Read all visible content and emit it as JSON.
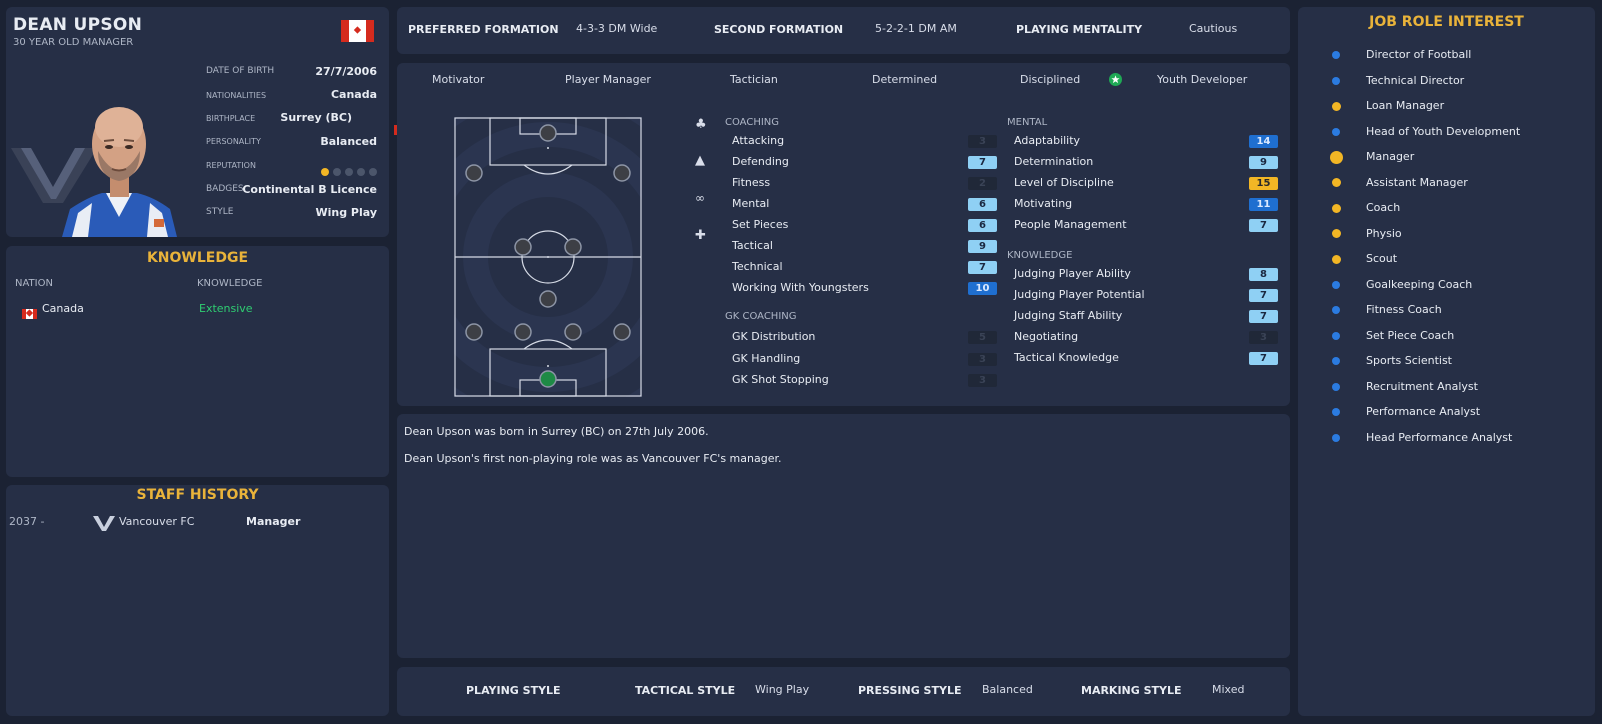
{
  "profile": {
    "name": "DEAN UPSON",
    "subtitle": "30 YEAR OLD MANAGER",
    "date_of_birth_label": "DATE OF BIRTH",
    "date_of_birth": "27/7/2006",
    "nationalities_label": "NATIONALITIES",
    "nationality": "Canada",
    "birthplace_label": "BIRTHPLACE",
    "birthplace": "Surrey (BC)",
    "personality_label": "PERSONALITY",
    "personality": "Balanced",
    "reputation_label": "REPUTATION",
    "reputation_stars": 1,
    "reputation_max": 5,
    "badges_label": "BADGES",
    "badges": "Continental B Licence",
    "style_label": "STYLE",
    "style": "Wing Play"
  },
  "knowledge": {
    "title": "KNOWLEDGE",
    "col_nation": "NATION",
    "col_knowledge": "KNOWLEDGE",
    "nation": "Canada",
    "level": "Extensive",
    "level_color": "#2fce72"
  },
  "history": {
    "title": "STAFF HISTORY",
    "year": "2037 -",
    "club": "Vancouver FC",
    "role": "Manager"
  },
  "formation": {
    "preferred_label": "PREFERRED FORMATION",
    "preferred": "4-3-3 DM Wide",
    "second_label": "SECOND FORMATION",
    "second": "5-2-2-1 DM AM",
    "mentality_label": "PLAYING MENTALITY",
    "mentality": "Cautious"
  },
  "traits": [
    "Motivator",
    "Player Manager",
    "Tactician",
    "Determined",
    "Disciplined",
    "Youth Developer"
  ],
  "coaching": {
    "head": "COACHING",
    "items": [
      {
        "name": "Attacking",
        "value": "3",
        "level": "dark"
      },
      {
        "name": "Defending",
        "value": "7",
        "level": "light"
      },
      {
        "name": "Fitness",
        "value": "2",
        "level": "dark"
      },
      {
        "name": "Mental",
        "value": "6",
        "level": "light"
      },
      {
        "name": "Set Pieces",
        "value": "6",
        "level": "light"
      },
      {
        "name": "Tactical",
        "value": "9",
        "level": "light"
      },
      {
        "name": "Technical",
        "value": "7",
        "level": "light"
      },
      {
        "name": "Working With Youngsters",
        "value": "10",
        "level": "blue"
      }
    ]
  },
  "gk_coaching": {
    "head": "GK COACHING",
    "items": [
      {
        "name": "GK Distribution",
        "value": "5",
        "level": "dark"
      },
      {
        "name": "GK Handling",
        "value": "3",
        "level": "dark"
      },
      {
        "name": "GK Shot Stopping",
        "value": "3",
        "level": "dark"
      }
    ]
  },
  "mental": {
    "head": "MENTAL",
    "items": [
      {
        "name": "Adaptability",
        "value": "14",
        "level": "blue"
      },
      {
        "name": "Determination",
        "value": "9",
        "level": "light"
      },
      {
        "name": "Level of Discipline",
        "value": "15",
        "level": "gold"
      },
      {
        "name": "Motivating",
        "value": "11",
        "level": "blue"
      },
      {
        "name": "People Management",
        "value": "7",
        "level": "light"
      }
    ]
  },
  "knowledge_attrs": {
    "head": "KNOWLEDGE",
    "items": [
      {
        "name": "Judging Player Ability",
        "value": "8",
        "level": "light"
      },
      {
        "name": "Judging Player Potential",
        "value": "7",
        "level": "light"
      },
      {
        "name": "Judging Staff Ability",
        "value": "7",
        "level": "light"
      },
      {
        "name": "Negotiating",
        "value": "3",
        "level": "dark"
      },
      {
        "name": "Tactical Knowledge",
        "value": "7",
        "level": "light"
      }
    ]
  },
  "description": {
    "line1": "Dean Upson was born in Surrey (BC) on 27th July 2006.",
    "line2": "Dean Upson's first non-playing role was as Vancouver FC's manager."
  },
  "styles": {
    "playing_label": "PLAYING STYLE",
    "playing": "",
    "tactical_label": "TACTICAL STYLE",
    "tactical": "Wing Play",
    "pressing_label": "PRESSING STYLE",
    "pressing": "Balanced",
    "marking_label": "MARKING STYLE",
    "marking": "Mixed"
  },
  "jobs": {
    "title": "JOB ROLE INTEREST",
    "items": [
      {
        "label": "Director of Football",
        "interest": "low"
      },
      {
        "label": "Technical Director",
        "interest": "low"
      },
      {
        "label": "Loan Manager",
        "interest": "medium"
      },
      {
        "label": "Head of Youth Development",
        "interest": "low"
      },
      {
        "label": "Manager",
        "interest": "high"
      },
      {
        "label": "Assistant Manager",
        "interest": "medium"
      },
      {
        "label": "Coach",
        "interest": "medium"
      },
      {
        "label": "Physio",
        "interest": "medium"
      },
      {
        "label": "Scout",
        "interest": "medium"
      },
      {
        "label": "Goalkeeping Coach",
        "interest": "low"
      },
      {
        "label": "Fitness Coach",
        "interest": "low"
      },
      {
        "label": "Set Piece Coach",
        "interest": "low"
      },
      {
        "label": "Sports Scientist",
        "interest": "low"
      },
      {
        "label": "Recruitment Analyst",
        "interest": "low"
      },
      {
        "label": "Performance Analyst",
        "interest": "low"
      },
      {
        "label": "Head Performance Analyst",
        "interest": "low"
      }
    ]
  },
  "icons": {
    "flag": "canada-flag-icon",
    "star": "star-badge-icon",
    "coaching": "coaching-icon",
    "cone": "training-cone-icon",
    "binoculars": "binoculars-icon",
    "medkit": "medical-kit-icon",
    "club": "vancouver-fc-crest-icon"
  },
  "colors": {
    "accent": "#e9b33a",
    "panel": "#262f46",
    "background": "#1b2233",
    "interest_low": "#2b7be0",
    "interest_medium": "#f2b625"
  }
}
